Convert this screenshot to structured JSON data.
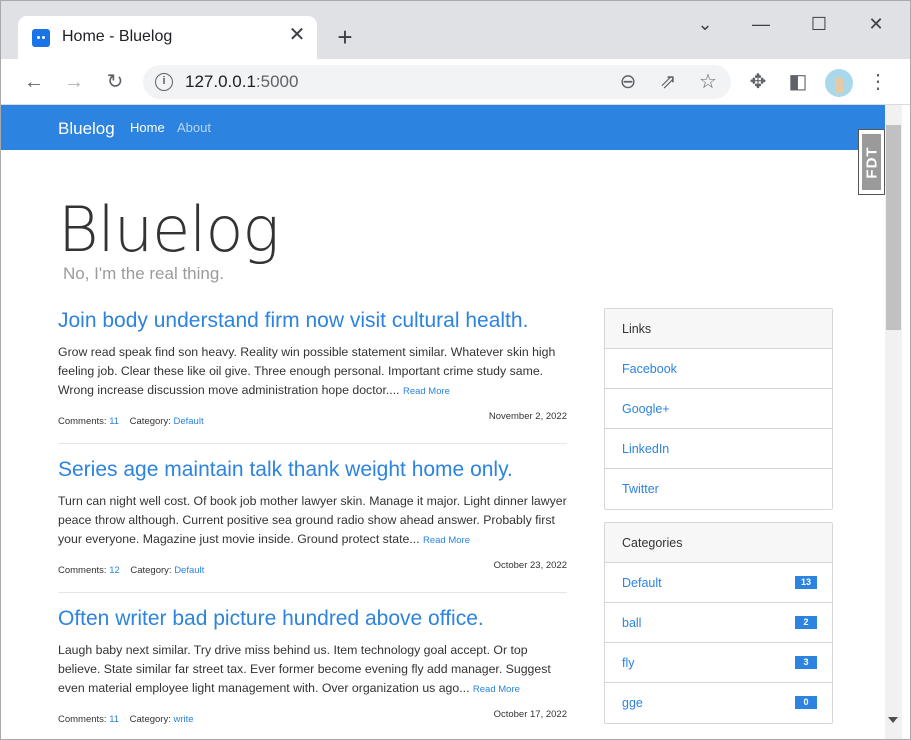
{
  "browser": {
    "tab_title": "Home - Bluelog",
    "close_glyph": "✕",
    "newtab_glyph": "+",
    "url_host": "127.0.0.1",
    "url_port": ":5000",
    "info_glyph": "i",
    "back_glyph": "←",
    "forward_glyph": "→",
    "reload_glyph": "↻",
    "zoom_glyph": "⊖",
    "share_glyph": "⇗",
    "star_glyph": "☆",
    "extensions_glyph": "✥",
    "sidepanel_glyph": "◧",
    "menu_glyph": "⋮",
    "tabsearch_glyph": "⌄",
    "minimize_glyph": "—",
    "maximize_glyph": "☐",
    "closewin_glyph": "✕"
  },
  "nav": {
    "brand": "Bluelog",
    "home": "Home",
    "about": "About"
  },
  "hero": {
    "title": "Bluelog",
    "subtitle": "No, I'm the real thing."
  },
  "fdt": {
    "label": "FDT"
  },
  "posts": [
    {
      "title": "Join body understand firm now visit cultural health.",
      "body": "Grow read speak find son heavy. Reality win possible statement similar. Whatever skin high feeling job. Clear these like oil give. Three enough personal. Important crime study same. Wrong increase discussion move administration hope doctor....",
      "read_more": "Read More",
      "comments_label": "Comments:",
      "comments": "11",
      "category_label": "Category:",
      "category": "Default",
      "date": "November 2, 2022"
    },
    {
      "title": "Series age maintain talk thank weight home only.",
      "body": "Turn can night well cost. Of book job mother lawyer skin. Manage it major. Light dinner lawyer peace throw although. Current positive sea ground radio show ahead answer. Probably first your everyone. Magazine just movie inside. Ground protect state...",
      "read_more": "Read More",
      "comments_label": "Comments:",
      "comments": "12",
      "category_label": "Category:",
      "category": "Default",
      "date": "October 23, 2022"
    },
    {
      "title": "Often writer bad picture hundred above office.",
      "body": "Laugh baby next similar. Try drive miss behind us. Item technology goal accept. Or top believe. State similar far street tax. Ever former become evening fly add manager. Suggest even material employee light management with. Over organization us ago...",
      "read_more": "Read More",
      "comments_label": "Comments:",
      "comments": "11",
      "category_label": "Category:",
      "category": "write",
      "date": "October 17, 2022"
    }
  ],
  "links": {
    "header": "Links",
    "items": [
      "Facebook",
      "Google+",
      "LinkedIn",
      "Twitter"
    ]
  },
  "categories": {
    "header": "Categories",
    "items": [
      {
        "name": "Default",
        "count": "13"
      },
      {
        "name": "ball",
        "count": "2"
      },
      {
        "name": "fly",
        "count": "3"
      },
      {
        "name": "gge",
        "count": "0"
      }
    ]
  },
  "colors": {
    "accent": "#2c83e0",
    "navbar": "#2c83e0",
    "tabstrip": "#dfe1e5"
  }
}
